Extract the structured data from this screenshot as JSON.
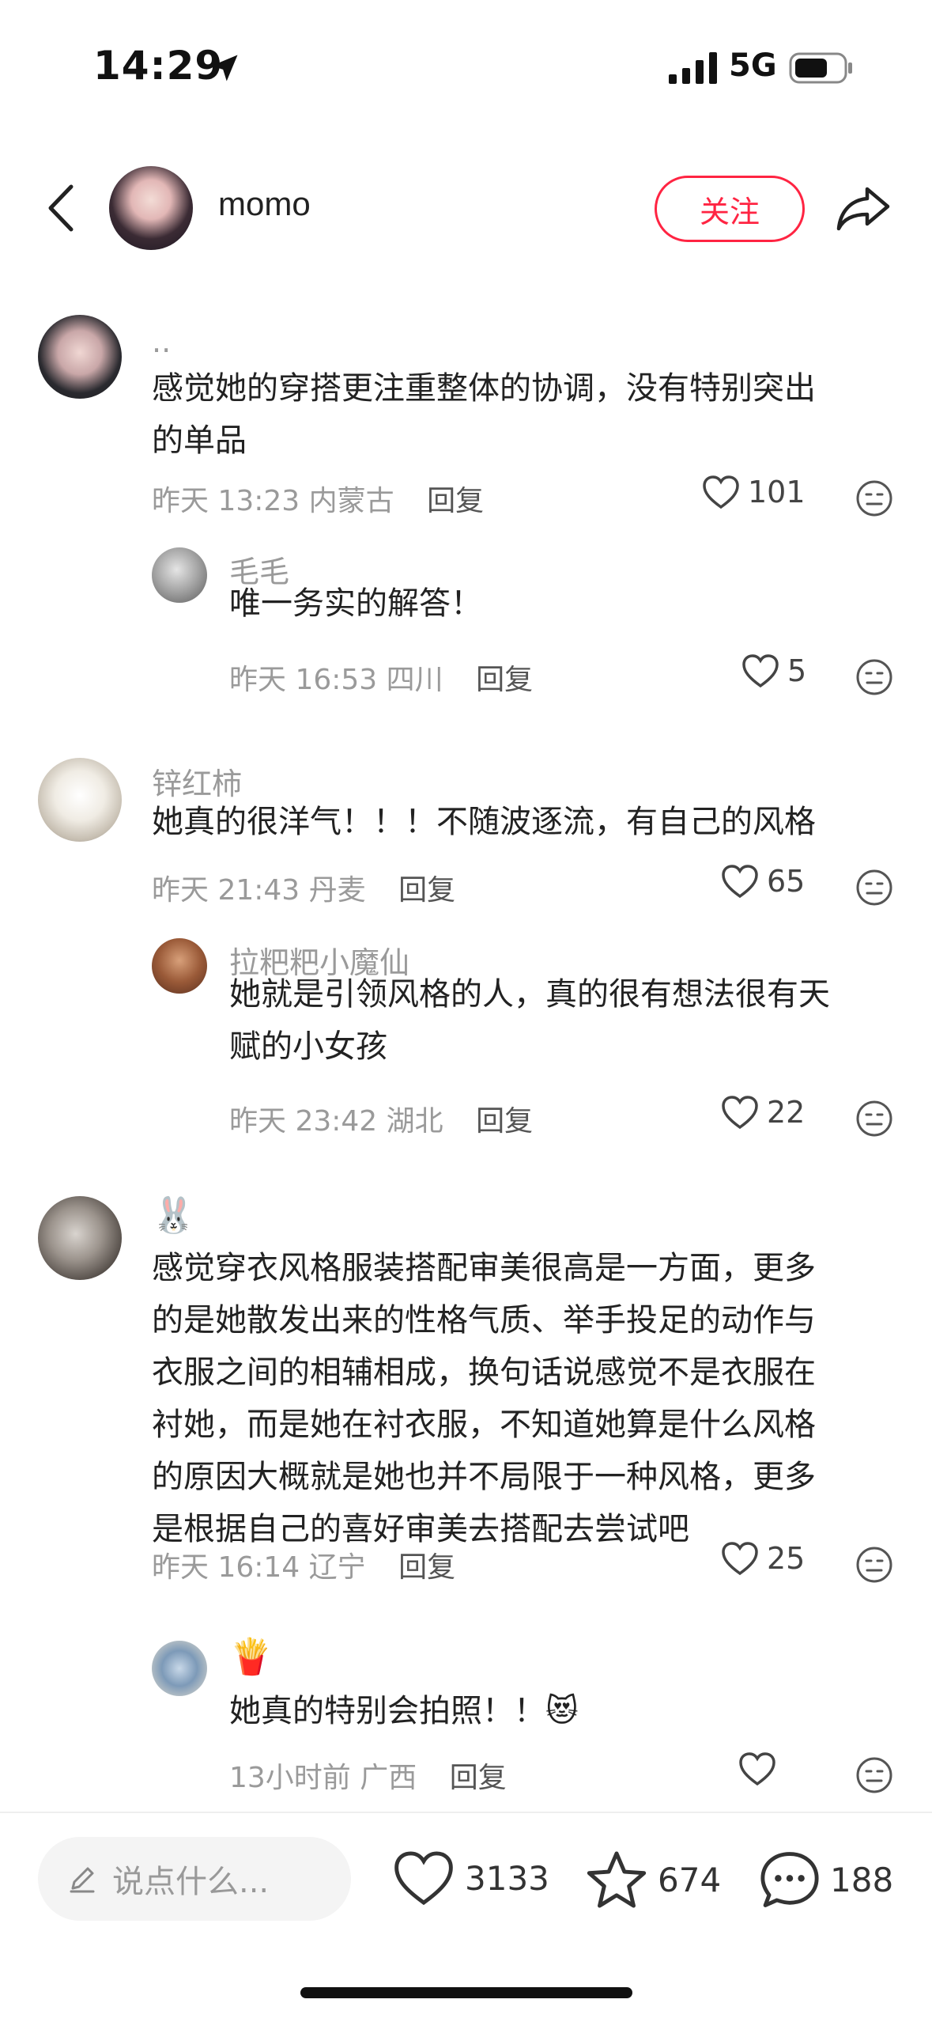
{
  "status_bar": {
    "time": "14:29",
    "network": "5G"
  },
  "header": {
    "name": "momo",
    "follow_label": "关注"
  },
  "comments": [
    {
      "name": "..",
      "text_lines": [
        "感觉她的穿搭更注重整体的协调，没有特别突出",
        "的单品"
      ],
      "time": "昨天 13:23",
      "location": "内蒙古",
      "reply_label": "回复",
      "likes": "101",
      "replies": [
        {
          "name": "毛毛",
          "text_lines": [
            "唯一务实的解答！"
          ],
          "time": "昨天 16:53",
          "location": "四川",
          "reply_label": "回复",
          "likes": "5"
        }
      ]
    },
    {
      "name": "锌红柿",
      "text_lines": [
        "她真的很洋气！！！不随波逐流，有自己的风格"
      ],
      "time": "昨天 21:43",
      "location": "丹麦",
      "reply_label": "回复",
      "likes": "65",
      "replies": [
        {
          "name": "拉粑粑小魔仙",
          "text_lines": [
            "她就是引领风格的人，真的很有想法很有天",
            "赋的小女孩"
          ],
          "time": "昨天 23:42",
          "location": "湖北",
          "reply_label": "回复",
          "likes": "22"
        }
      ]
    },
    {
      "name": "🐰",
      "text_lines": [
        "感觉穿衣风格服装搭配审美很高是一方面，更多",
        "的是她散发出来的性格气质、举手投足的动作与",
        "衣服之间的相辅相成，换句话说感觉不是衣服在",
        "衬她，而是她在衬衣服，不知道她算是什么风格",
        "的原因大概就是她也并不局限于一种风格，更多",
        "是根据自己的喜好审美去搭配去尝试吧"
      ],
      "time": "昨天 16:14",
      "location": "辽宁",
      "reply_label": "回复",
      "likes": "25",
      "replies": [
        {
          "name": "🍟",
          "text_lines": [
            "她真的特别会拍照！！😻"
          ],
          "time": "13小时前",
          "location": "广西",
          "reply_label": "回复",
          "likes": ""
        }
      ]
    }
  ],
  "bottom_bar": {
    "input_placeholder": "说点什么...",
    "like_count": "3133",
    "collect_count": "674",
    "comment_count": "188"
  },
  "colors": {
    "accent": "#ff2442",
    "meta_text": "#9a9a9a"
  }
}
